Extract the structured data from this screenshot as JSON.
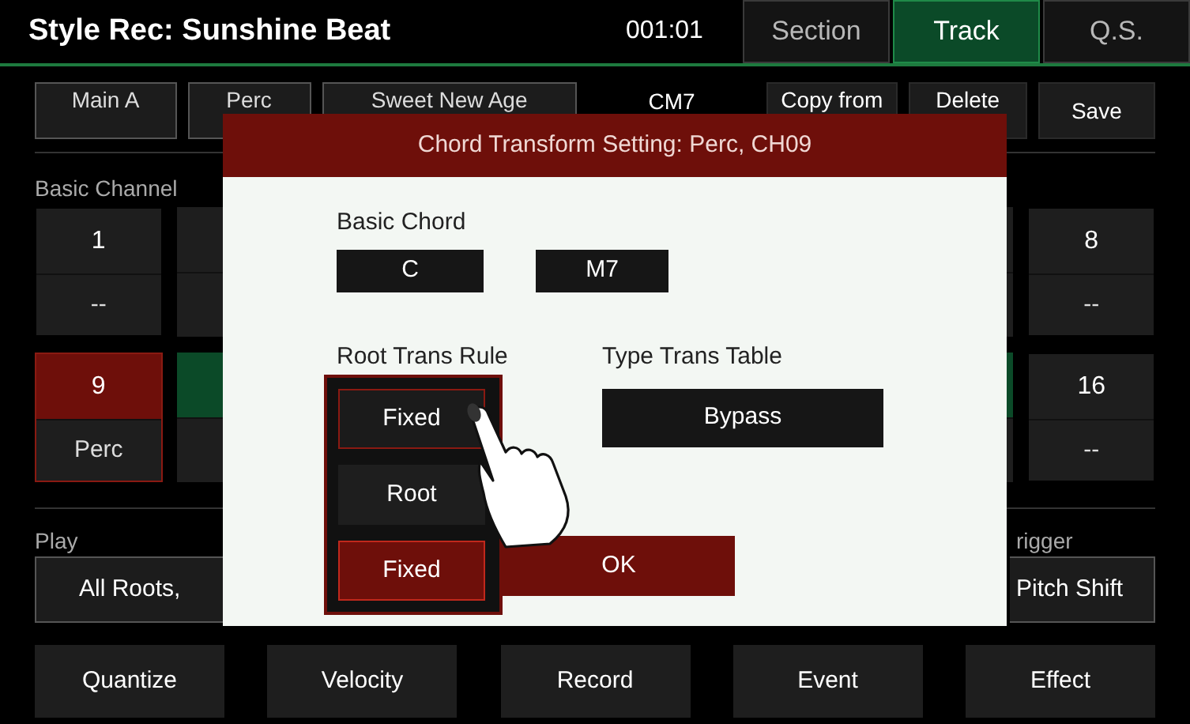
{
  "header": {
    "title": "Style Rec: Sunshine Beat",
    "position": "001:01",
    "tabs": [
      {
        "label": "Section",
        "selected": false
      },
      {
        "label": "Track",
        "selected": true
      },
      {
        "label": "Q.S.",
        "selected": false
      }
    ]
  },
  "toolbar": {
    "buttons": [
      "Main A",
      "Perc",
      "Sweet New Age"
    ],
    "chord": "CM7",
    "actions": [
      "Copy from",
      "Delete",
      "Save"
    ]
  },
  "channels": {
    "label": "Basic Channel",
    "rows": [
      [
        {
          "kind": "channel",
          "number": "1",
          "name": "--",
          "selected": false,
          "active": false
        },
        {
          "kind": "partial",
          "active": false
        },
        {
          "kind": "partial",
          "active": false
        },
        {
          "kind": "channel",
          "number": "8",
          "name": "--",
          "selected": false,
          "active": false
        }
      ],
      [
        {
          "kind": "channel",
          "number": "9",
          "name": "Perc",
          "selected": true,
          "active": false
        },
        {
          "kind": "partial",
          "active": true
        },
        {
          "kind": "partial",
          "active": true
        },
        {
          "kind": "channel",
          "number": "16",
          "name": "--",
          "selected": false,
          "active": false
        }
      ]
    ]
  },
  "play": {
    "label": "Play",
    "value": "All Roots,"
  },
  "trigger": {
    "label": "rigger",
    "value": "Pitch Shift"
  },
  "bottom_buttons": [
    "Quantize",
    "Velocity",
    "Record",
    "Event",
    "Effect"
  ],
  "dialog": {
    "title": "Chord Transform Setting: Perc, CH09",
    "basic_chord_label": "Basic Chord",
    "basic_chord": [
      "C",
      "M7"
    ],
    "root_rule_label": "Root Trans Rule",
    "root_rule_value": "Fixed",
    "root_rule_options": [
      {
        "label": "Root",
        "selected": false
      },
      {
        "label": "Fixed",
        "selected": true
      }
    ],
    "type_table_label": "Type Trans Table",
    "type_table_value": "Bypass",
    "ok": "OK"
  }
}
